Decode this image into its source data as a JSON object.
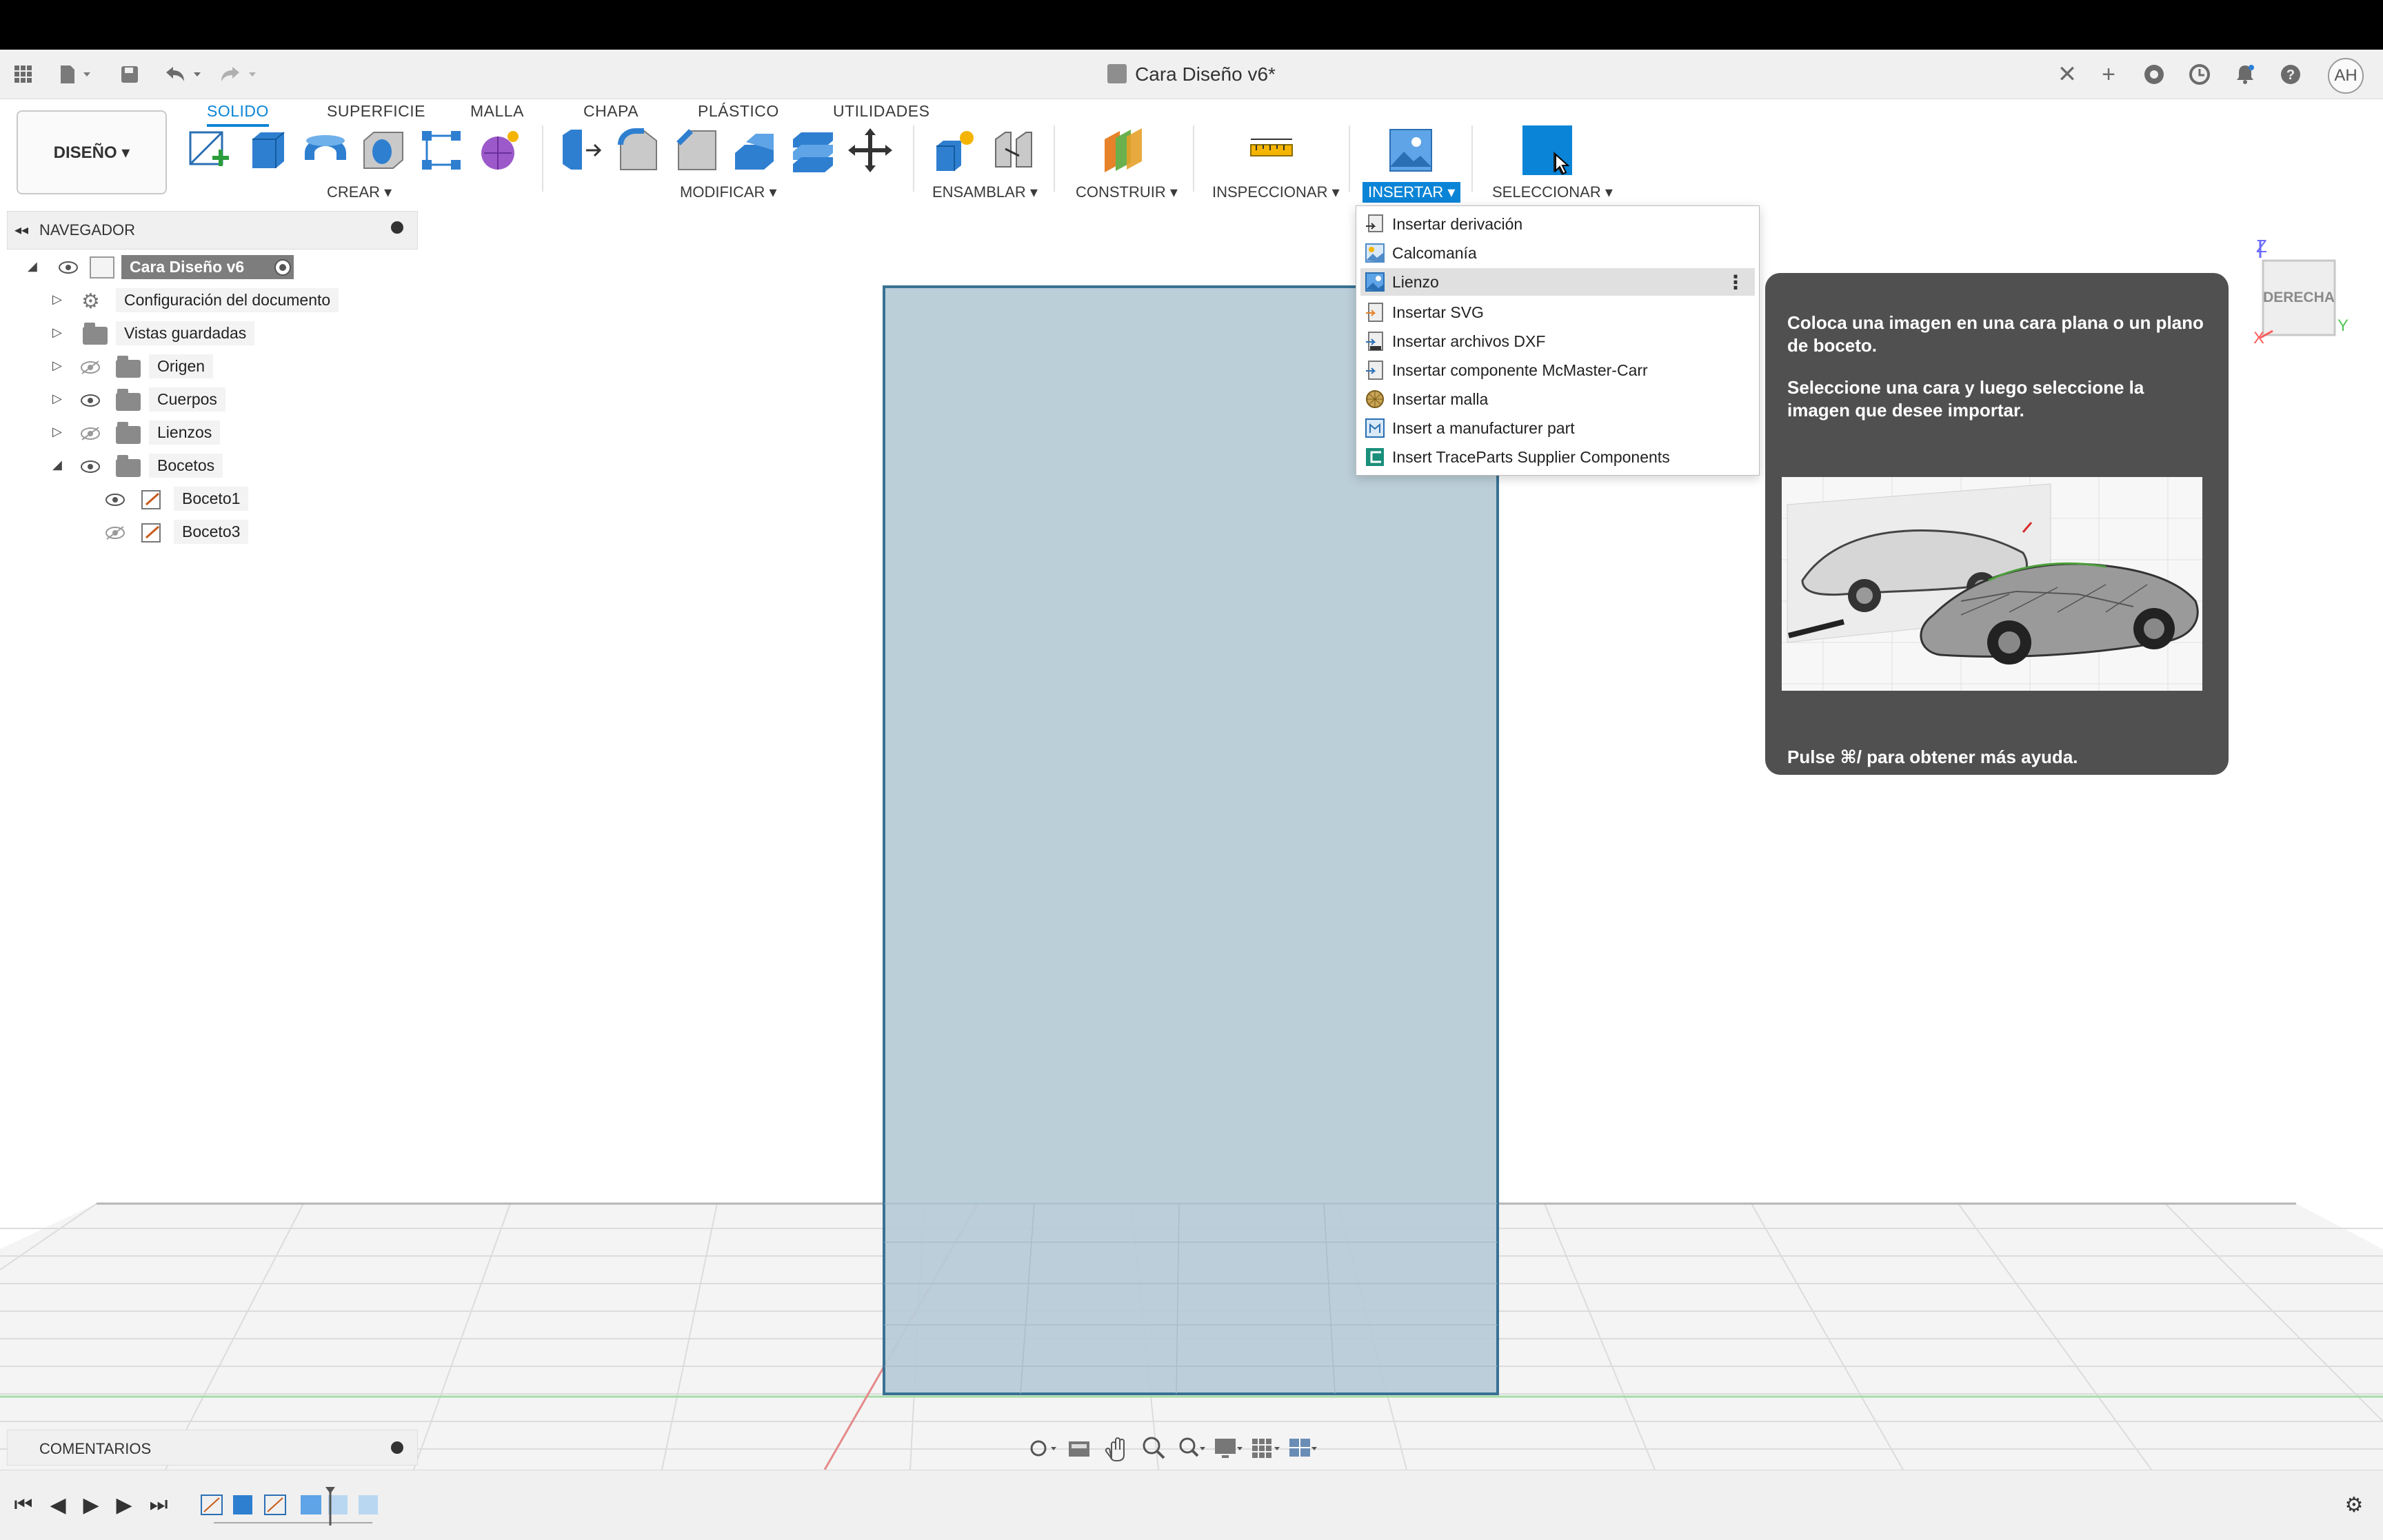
{
  "window": {
    "title": "Cara Diseño v6*",
    "user_initials": "AH"
  },
  "toolbar": {
    "workspace_button": "DISEÑO ▾",
    "tabs": [
      "SOLIDO",
      "SUPERFICIE",
      "MALLA",
      "CHAPA",
      "PLÁSTICO",
      "UTILIDADES"
    ],
    "active_tab": "SOLIDO",
    "groups": {
      "crear": "CREAR ▾",
      "modificar": "MODIFICAR ▾",
      "ensamblar": "ENSAMBLAR ▾",
      "construir": "CONSTRUIR ▾",
      "inspeccionar": "INSPECCIONAR ▾",
      "insertar": "INSERTAR ▾",
      "seleccionar": "SELECCIONAR ▾"
    }
  },
  "navigator": {
    "title": "NAVEGADOR",
    "root": "Cara Diseño v6",
    "items": [
      {
        "label": "Configuración del documento"
      },
      {
        "label": "Vistas guardadas"
      },
      {
        "label": "Origen"
      },
      {
        "label": "Cuerpos"
      },
      {
        "label": "Lienzos"
      },
      {
        "label": "Bocetos"
      },
      {
        "label": "Boceto1"
      },
      {
        "label": "Boceto3"
      }
    ]
  },
  "insert_menu": {
    "items": [
      "Insertar derivación",
      "Calcomanía",
      "Lienzo",
      "Insertar SVG",
      "Insertar archivos DXF",
      "Insertar componente McMaster-Carr",
      "Insertar malla",
      "Insert a manufacturer part",
      "Insert TraceParts Supplier Components"
    ],
    "highlighted": "Lienzo"
  },
  "tooltip": {
    "line1": "Coloca una imagen en una cara plana o un plano de boceto.",
    "line2": "Seleccione una cara y luego seleccione la imagen que desee importar.",
    "help": "Pulse ⌘/ para obtener más ayuda."
  },
  "viewcube": {
    "face": "DERECHA",
    "axis_z": "Z",
    "axis_x": "X",
    "axis_y": "Y"
  },
  "comments": {
    "title": "COMENTARIOS"
  },
  "colors": {
    "accent": "#0a84d6",
    "body": "#b8cdd8",
    "grid": "#d9d9d9",
    "tooltip_bg": "#505050"
  }
}
